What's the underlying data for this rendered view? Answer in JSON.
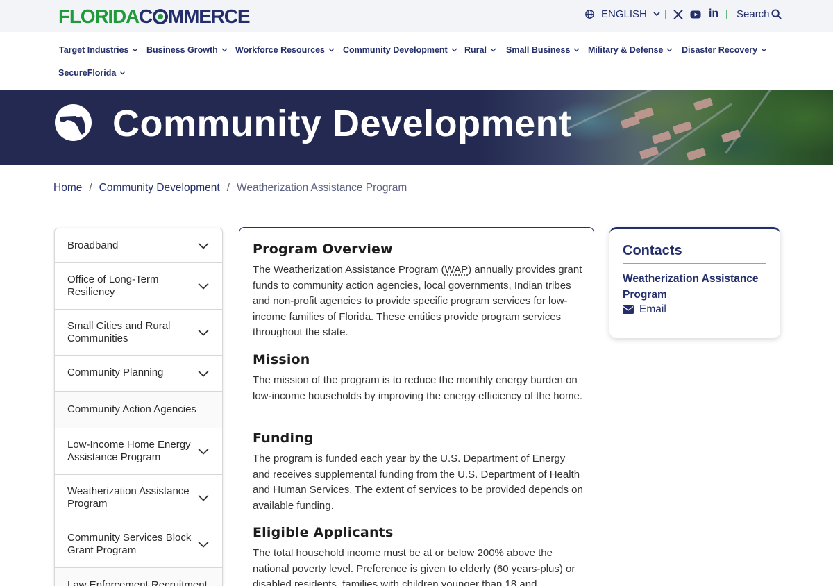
{
  "header": {
    "logo": {
      "part1": "FLORIDA",
      "part2": "C",
      "part3": "MMERCE"
    },
    "language": "ENGLISH",
    "separator": "|",
    "search_label": "Search",
    "social": [
      "x-icon",
      "youtube-icon",
      "linkedin-icon"
    ],
    "linkedin_text": "in"
  },
  "nav": {
    "items": [
      {
        "label": "Target Industries"
      },
      {
        "label": "Business Growth"
      },
      {
        "label": "Workforce Resources"
      },
      {
        "label": "Community Development"
      },
      {
        "label": "Rural"
      },
      {
        "label": "Small Business"
      },
      {
        "label": "Military & Defense"
      },
      {
        "label": "Disaster Recovery"
      },
      {
        "label": "SecureFlorida"
      }
    ]
  },
  "hero": {
    "title": "Community Development"
  },
  "breadcrumb": {
    "home": "Home",
    "sep": "/",
    "parent": "Community Development",
    "current": "Weatherization Assistance Program"
  },
  "sidebar": {
    "items": [
      {
        "label": "Broadband",
        "expandable": true
      },
      {
        "label": "Office of Long-Term Resiliency",
        "expandable": true
      },
      {
        "label": "Small Cities and Rural Communities",
        "expandable": true
      },
      {
        "label": "Community Planning",
        "expandable": true
      },
      {
        "label": "Community Action Agencies",
        "expandable": false
      },
      {
        "label": "Low-Income Home Energy Assistance Program",
        "expandable": true
      },
      {
        "label": "Weatherization Assistance Program",
        "expandable": true
      },
      {
        "label": "Community Services Block Grant Program",
        "expandable": true
      },
      {
        "label": "Law Enforcement Recruitment",
        "expandable": false
      }
    ]
  },
  "content": {
    "overview_heading": "Program Overview",
    "overview_pre": "The Weatherization Assistance Program (",
    "overview_abbr": "WAP",
    "overview_post": ") annually provides grant funds to community action agencies, local governments, Indian tribes and non-profit agencies to provide specific program services for low-income families of Florida. These entities provide program services throughout the state.",
    "mission_heading": "Mission",
    "mission_text": "The mission of the program is to reduce the monthly energy burden on low-income households by improving the energy efficiency of the home.",
    "funding_heading": "Funding",
    "funding_text": "The program is funded each year by the U.S. Department of Energy and receives supplemental funding from the U.S. Department of Health and Human Services. The extent of services to be provided depends on available funding.",
    "eligible_heading": "Eligible Applicants",
    "eligible_text": "The total household income must be at or below 200% above the national poverty level. Preference is given to elderly (60 years-plus) or disabled residents, families with children younger than 18 and"
  },
  "contacts": {
    "heading": "Contacts",
    "program": "Weatherization Assistance Program",
    "email_label": "Email"
  },
  "colors": {
    "brand_navy": "#232e6b",
    "brand_green": "#1f9b3a",
    "hero_bg": "#232950",
    "topbar_bg": "#f2f4f8"
  }
}
